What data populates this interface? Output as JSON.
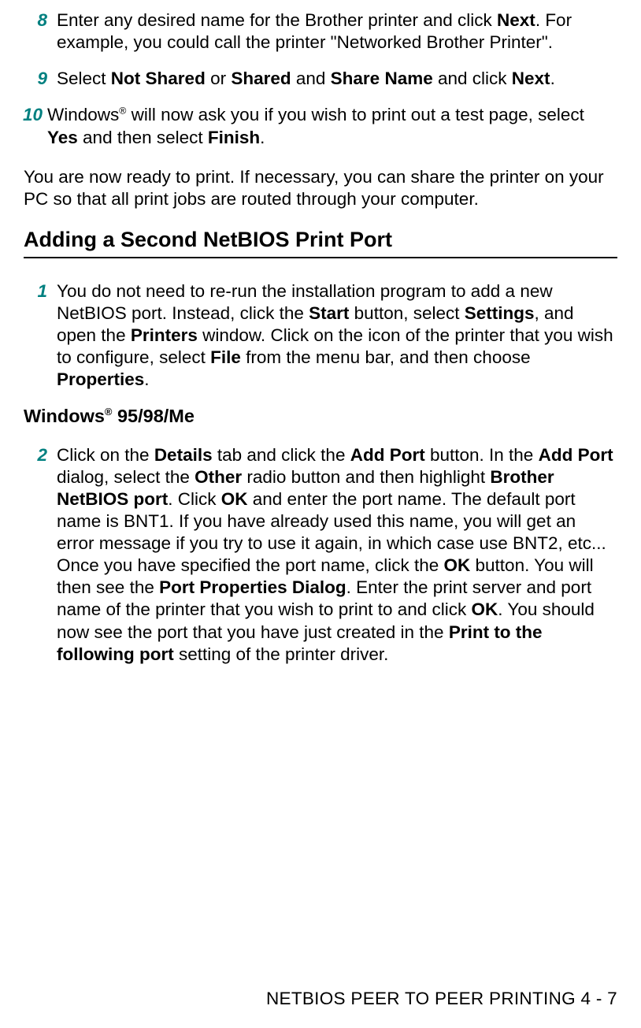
{
  "steps_top": [
    {
      "num": "8",
      "html": "Enter any desired name for the Brother printer and click <b>Next</b>. For example, you could call the printer \"Networked Brother Printer\"."
    },
    {
      "num": "9",
      "html": "Select <b>Not Shared</b> or <b>Shared</b> and <b>Share Name</b> and click <b>Next</b>."
    },
    {
      "num": "10",
      "html": "Windows<span class=\"sup\">®</span> will now ask you if you wish to print out a test page, select <b>Yes</b> and then select <b>Finish</b>."
    }
  ],
  "paragraph_ready": "You are now ready to print. If necessary, you can share the printer on your PC so that all print jobs are routed through your computer.",
  "heading_second_port": "Adding a Second NetBIOS Print Port",
  "step_second_port": {
    "num": "1",
    "html": "You do not need to re-run the installation program to add a new NetBIOS port. Instead, click the <b>Start</b> button, select <b>Settings</b>, and open the <b>Printers</b> window. Click on the icon of the printer that you wish to configure, select <b>File</b> from the menu bar, and then choose <b>Properties</b>."
  },
  "heading_win9598": "Windows<span class=\"sup\">®</span> 95/98/Me",
  "step_win9598": {
    "num": "2",
    "html": "Click on the <b>Details</b> tab and click the <b>Add Port</b> button. In the <b>Add Port</b> dialog, select the <b>Other</b> radio button and then highlight <b>Brother NetBIOS port</b>. Click <b>OK</b> and enter the port name. The default port name is BNT1. If you have already used this name, you will get an error message if you try to use it again, in which case use BNT2, etc... Once you have specified the port name, click the <b>OK</b> button. You will then see the <b>Port Properties Dialog</b>. Enter the print server and port name of the printer that you wish to print to and click <b>OK</b>. You should now see the port that you have just created in the <b>Print to the following port</b> setting of the printer driver."
  },
  "footer": "NETBIOS PEER TO PEER PRINTING 4 - 7"
}
